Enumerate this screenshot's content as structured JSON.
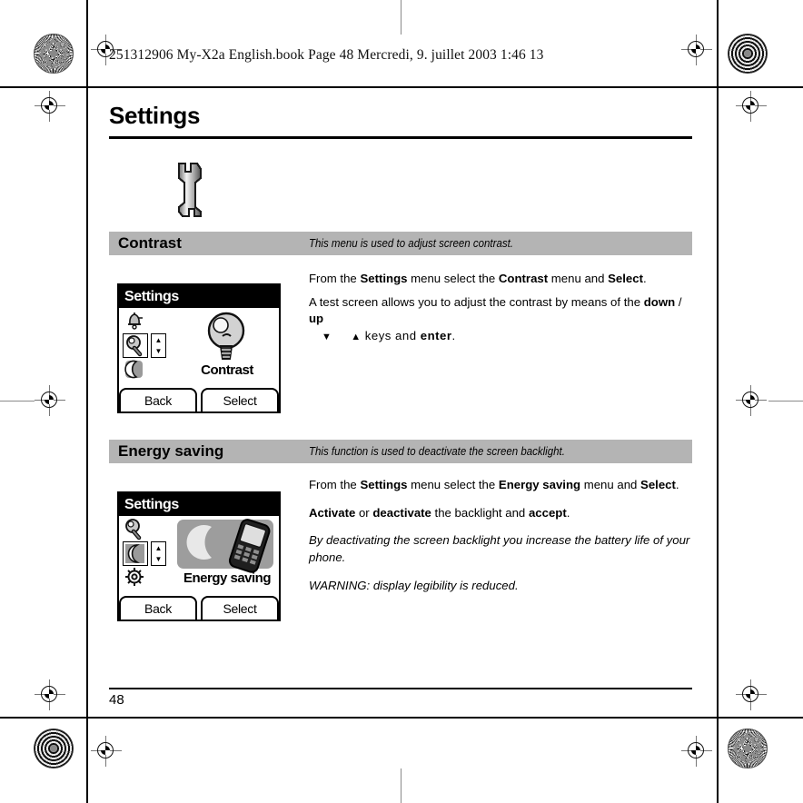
{
  "file_header": "251312906 My-X2a English.book  Page 48  Mercredi, 9. juillet 2003  1:46 13",
  "chapter": {
    "title": "Settings",
    "icon": "wrench-icon"
  },
  "page_number": "48",
  "colors": {
    "section_bar": "#b4b4b4",
    "text": "#000000",
    "lcd_titlebar": "#000000"
  },
  "sections": [
    {
      "name": "Contrast",
      "description": "This menu is used to adjust screen contrast.",
      "paragraphs": [
        {
          "id": "p1",
          "runs": [
            {
              "t": "From the ",
              "b": false
            },
            {
              "t": "Settings",
              "b": true
            },
            {
              "t": " menu select the ",
              "b": false
            },
            {
              "t": "Contrast",
              "b": true
            },
            {
              "t": " menu and ",
              "b": false
            },
            {
              "t": "Select",
              "b": true
            },
            {
              "t": ".",
              "b": false
            }
          ]
        },
        {
          "id": "p2",
          "runs": [
            {
              "t": "A test screen allows you to adjust the contrast by means of the ",
              "b": false
            },
            {
              "t": "down",
              "b": true
            },
            {
              "t": " / ",
              "b": false
            },
            {
              "t": "up",
              "b": true
            }
          ]
        }
      ],
      "arrow_line": {
        "down_glyph": "▼",
        "up_glyph": "▲",
        "text_after": " keys and ",
        "bold_word": "enter",
        "tail": "."
      },
      "lcd": {
        "title": "Settings",
        "caption": "Contrast",
        "icons": [
          "bell-icon",
          "lightbulb-icon",
          "moon-icon"
        ],
        "selected_icon_index": 1,
        "hero": "lightbulb-large-icon",
        "spinner_up": "▲",
        "spinner_down": "▼",
        "softkey_left": "Back",
        "softkey_right": "Select"
      }
    },
    {
      "name": "Energy saving",
      "description": "This function is used to deactivate the screen backlight.",
      "paragraphs": [
        {
          "id": "p1",
          "runs": [
            {
              "t": "From the ",
              "b": false
            },
            {
              "t": "Settings",
              "b": true
            },
            {
              "t": " menu select the ",
              "b": false
            },
            {
              "t": "Energy saving",
              "b": true
            },
            {
              "t": " menu and ",
              "b": false
            },
            {
              "t": "Select",
              "b": true
            },
            {
              "t": ".",
              "b": false
            }
          ]
        },
        {
          "id": "p2",
          "runs": [
            {
              "t": "Activate",
              "b": true
            },
            {
              "t": " or ",
              "b": false
            },
            {
              "t": "deactivate",
              "b": true
            },
            {
              "t": " the backlight and ",
              "b": false
            },
            {
              "t": "accept",
              "b": true
            },
            {
              "t": ".",
              "b": false
            }
          ]
        },
        {
          "id": "p3",
          "italic": true,
          "runs": [
            {
              "t": "By deactivating the screen backlight you increase the battery life of your phone.",
              "b": false
            }
          ]
        },
        {
          "id": "p4",
          "italic": true,
          "runs": [
            {
              "t": "WARNING: display legibility is reduced.",
              "b": false
            }
          ]
        }
      ],
      "lcd": {
        "title": "Settings",
        "caption": "Energy saving",
        "icons": [
          "lightbulb-icon",
          "moon-icon",
          "gear-icon"
        ],
        "selected_icon_index": 1,
        "hero": "moon-phone-icon",
        "spinner_up": "▲",
        "spinner_down": "▼",
        "softkey_left": "Back",
        "softkey_right": "Select"
      }
    }
  ]
}
